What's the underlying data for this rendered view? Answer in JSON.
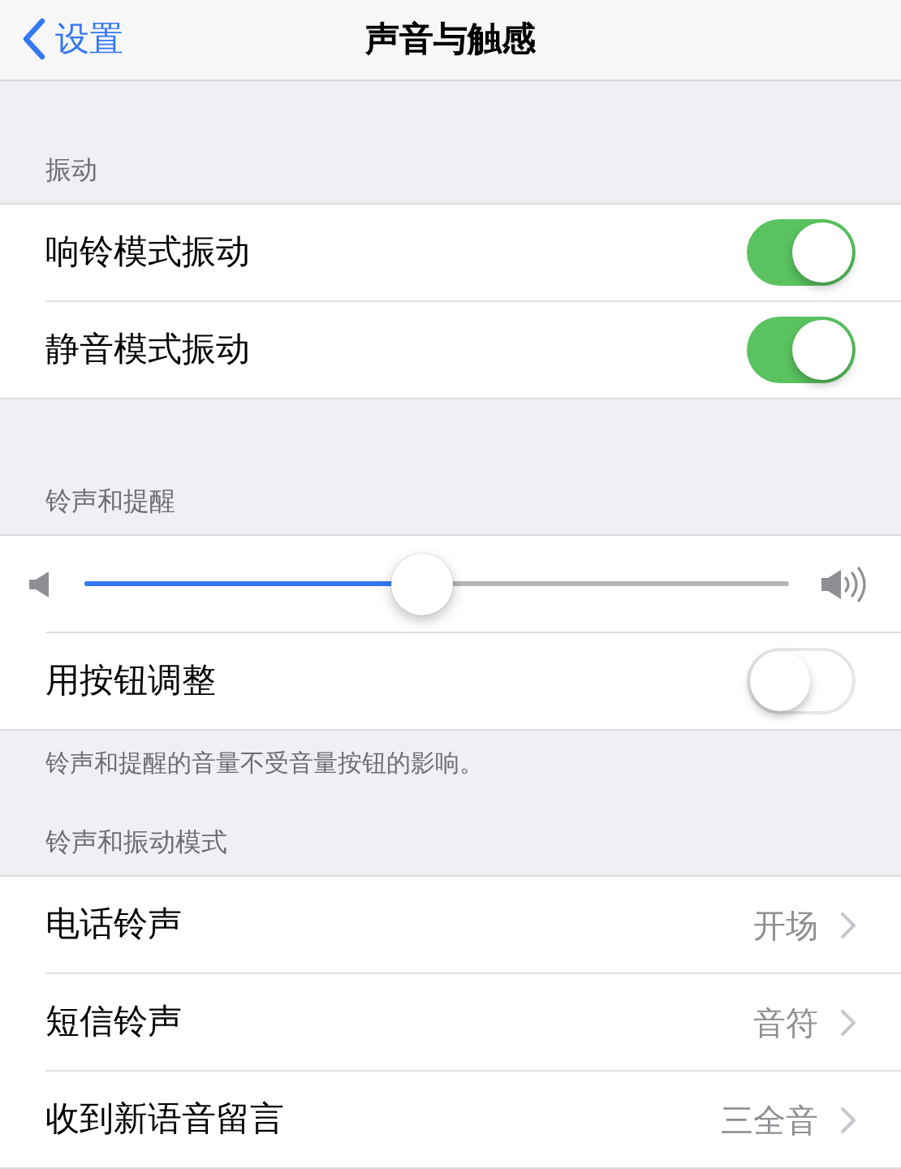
{
  "nav": {
    "back": "设置",
    "title": "声音与触感"
  },
  "sections": [
    {
      "header": "振动",
      "rows": [
        {
          "kind": "toggle",
          "label": "响铃模式振动",
          "on": true
        },
        {
          "kind": "toggle",
          "label": "静音模式振动",
          "on": true
        }
      ]
    },
    {
      "header": "铃声和提醒",
      "rows": [
        {
          "kind": "slider",
          "level": 0.48
        },
        {
          "kind": "toggle",
          "label": "用按钮调整",
          "on": false
        }
      ],
      "footer": "铃声和提醒的音量不受音量按钮的影响。"
    },
    {
      "header": "铃声和振动模式",
      "rows": [
        {
          "kind": "link",
          "label": "电话铃声",
          "value": "开场"
        },
        {
          "kind": "link",
          "label": "短信铃声",
          "value": "音符"
        },
        {
          "kind": "link",
          "label": "收到新语音留言",
          "value": "三全音"
        }
      ]
    }
  ]
}
